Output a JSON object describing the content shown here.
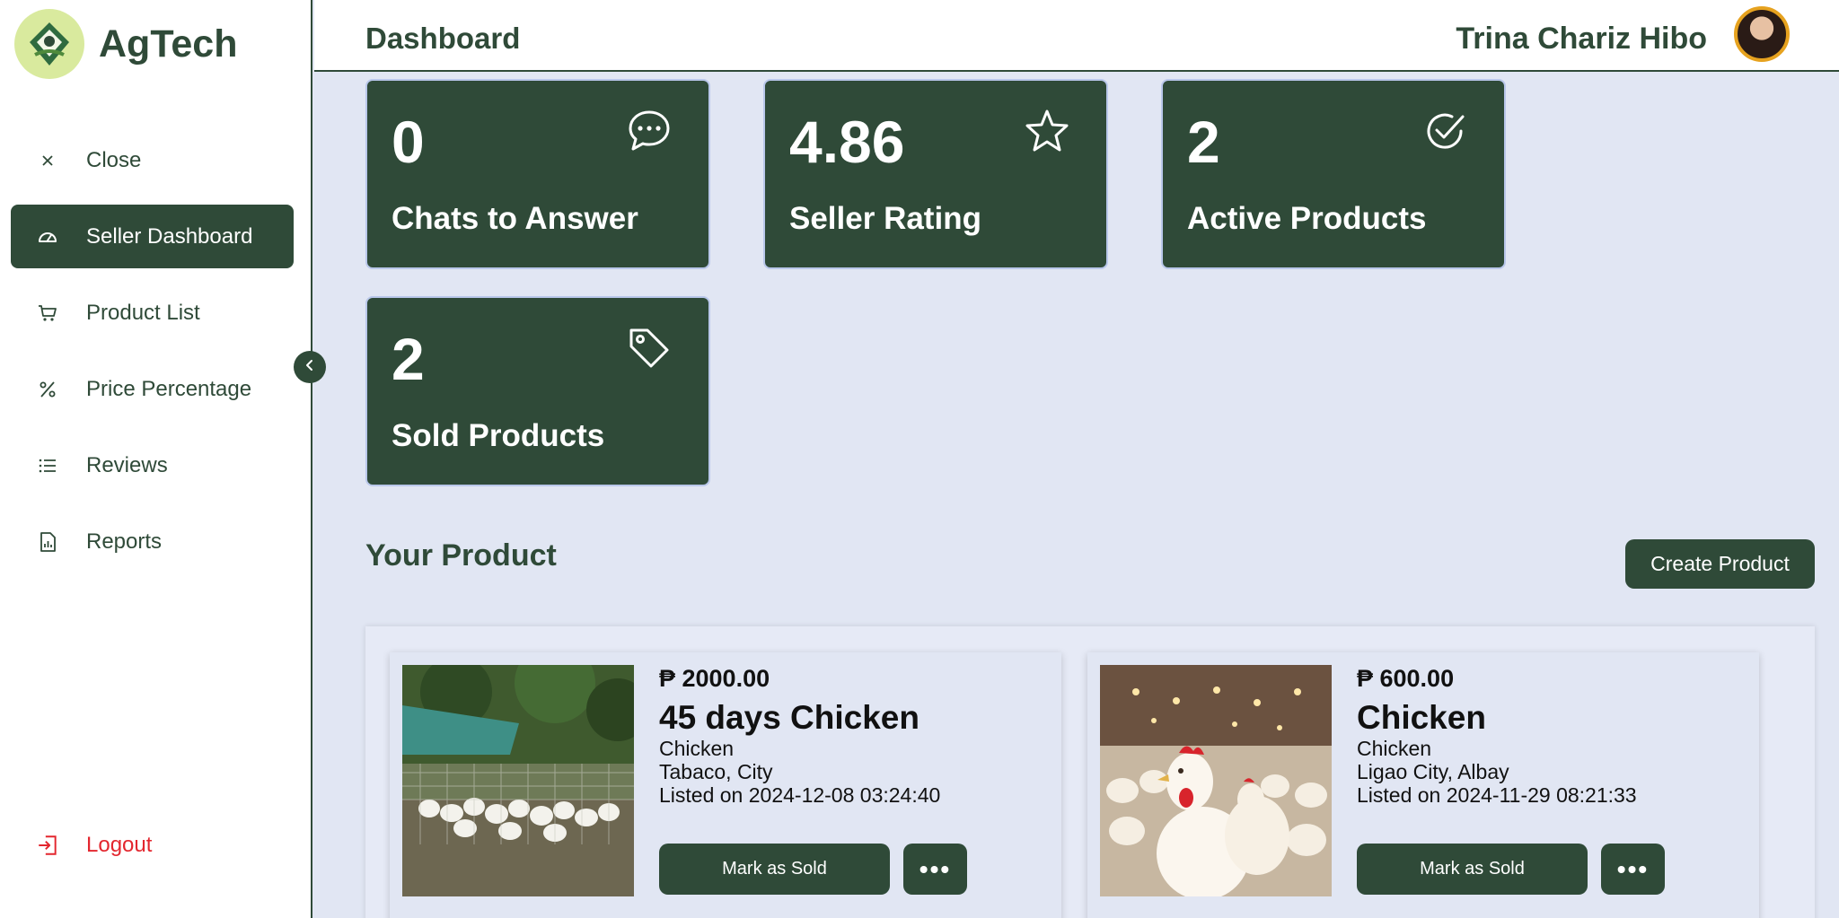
{
  "brand": {
    "name": "AgTech"
  },
  "sidebar": {
    "items": [
      {
        "label": "Close",
        "icon": "close-icon"
      },
      {
        "label": "Seller Dashboard",
        "icon": "dashboard-gauge-icon",
        "active": true
      },
      {
        "label": "Product List",
        "icon": "cart-icon"
      },
      {
        "label": "Price Percentage",
        "icon": "percent-icon"
      },
      {
        "label": "Reviews",
        "icon": "list-icon"
      },
      {
        "label": "Reports",
        "icon": "report-icon"
      }
    ],
    "logout": {
      "label": "Logout",
      "icon": "logout-icon"
    }
  },
  "header": {
    "title": "Dashboard",
    "user_name": "Trina Chariz Hibo"
  },
  "stats": [
    {
      "value": "0",
      "label": "Chats to Answer",
      "icon": "chat-icon"
    },
    {
      "value": "4.86",
      "label": "Seller Rating",
      "icon": "star-icon"
    },
    {
      "value": "2",
      "label": "Active Products",
      "icon": "check-circle-icon"
    },
    {
      "value": "2",
      "label": "Sold Products",
      "icon": "tag-icon"
    }
  ],
  "products_section": {
    "title": "Your Product",
    "create_label": "Create Product"
  },
  "products": [
    {
      "price": "₱ 2000.00",
      "name": "45 days Chicken",
      "category": "Chicken",
      "location": "Tabaco, City",
      "listed": "Listed on 2024-12-08 03:24:40",
      "mark_sold_label": "Mark as Sold",
      "more_label": "•••"
    },
    {
      "price": "₱ 600.00",
      "name": "Chicken",
      "category": "Chicken",
      "location": "Ligao City, Albay",
      "listed": "Listed on 2024-11-29 08:21:33",
      "mark_sold_label": "Mark as Sold",
      "more_label": "•••"
    }
  ],
  "colors": {
    "primary": "#2f4a38",
    "background": "#e1e6f3",
    "logout": "#e3262e",
    "avatar_ring": "#e6a21f"
  }
}
